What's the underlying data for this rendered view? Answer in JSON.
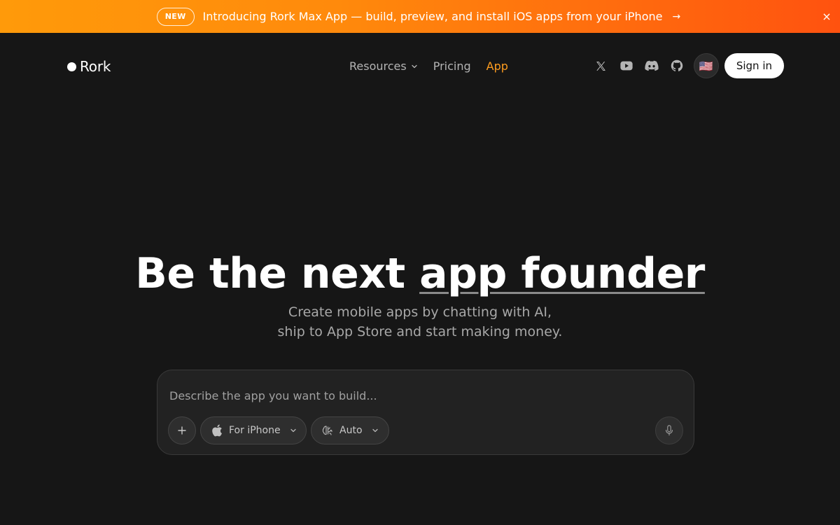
{
  "banner": {
    "badge": "NEW",
    "text": "Introducing Rork Max App — build, preview, and install iOS apps from your iPhone",
    "arrow": "→",
    "close_icon": "×"
  },
  "header": {
    "logo_text": "Rork",
    "nav": [
      {
        "label": "Resources",
        "has_dropdown": true
      },
      {
        "label": "Pricing"
      },
      {
        "label": "App",
        "active": true
      }
    ],
    "social_icons": [
      "x-icon",
      "youtube-icon",
      "discord-icon",
      "github-icon"
    ],
    "language_flag": "🇺🇸",
    "signin_label": "Sign in"
  },
  "hero": {
    "title_plain": "Be the next ",
    "title_underlined": "app founder",
    "subtitle_line1": "Create mobile apps by chatting with AI,",
    "subtitle_line2": "ship to App Store and start making money."
  },
  "prompt": {
    "placeholder": "Describe the app you want to build...",
    "device_label": "For iPhone",
    "model_label": "Auto"
  },
  "colors": {
    "background": "#161616",
    "accent": "#ff9d1f",
    "banner_start": "#ff9a0a",
    "banner_end": "#ff520f"
  }
}
